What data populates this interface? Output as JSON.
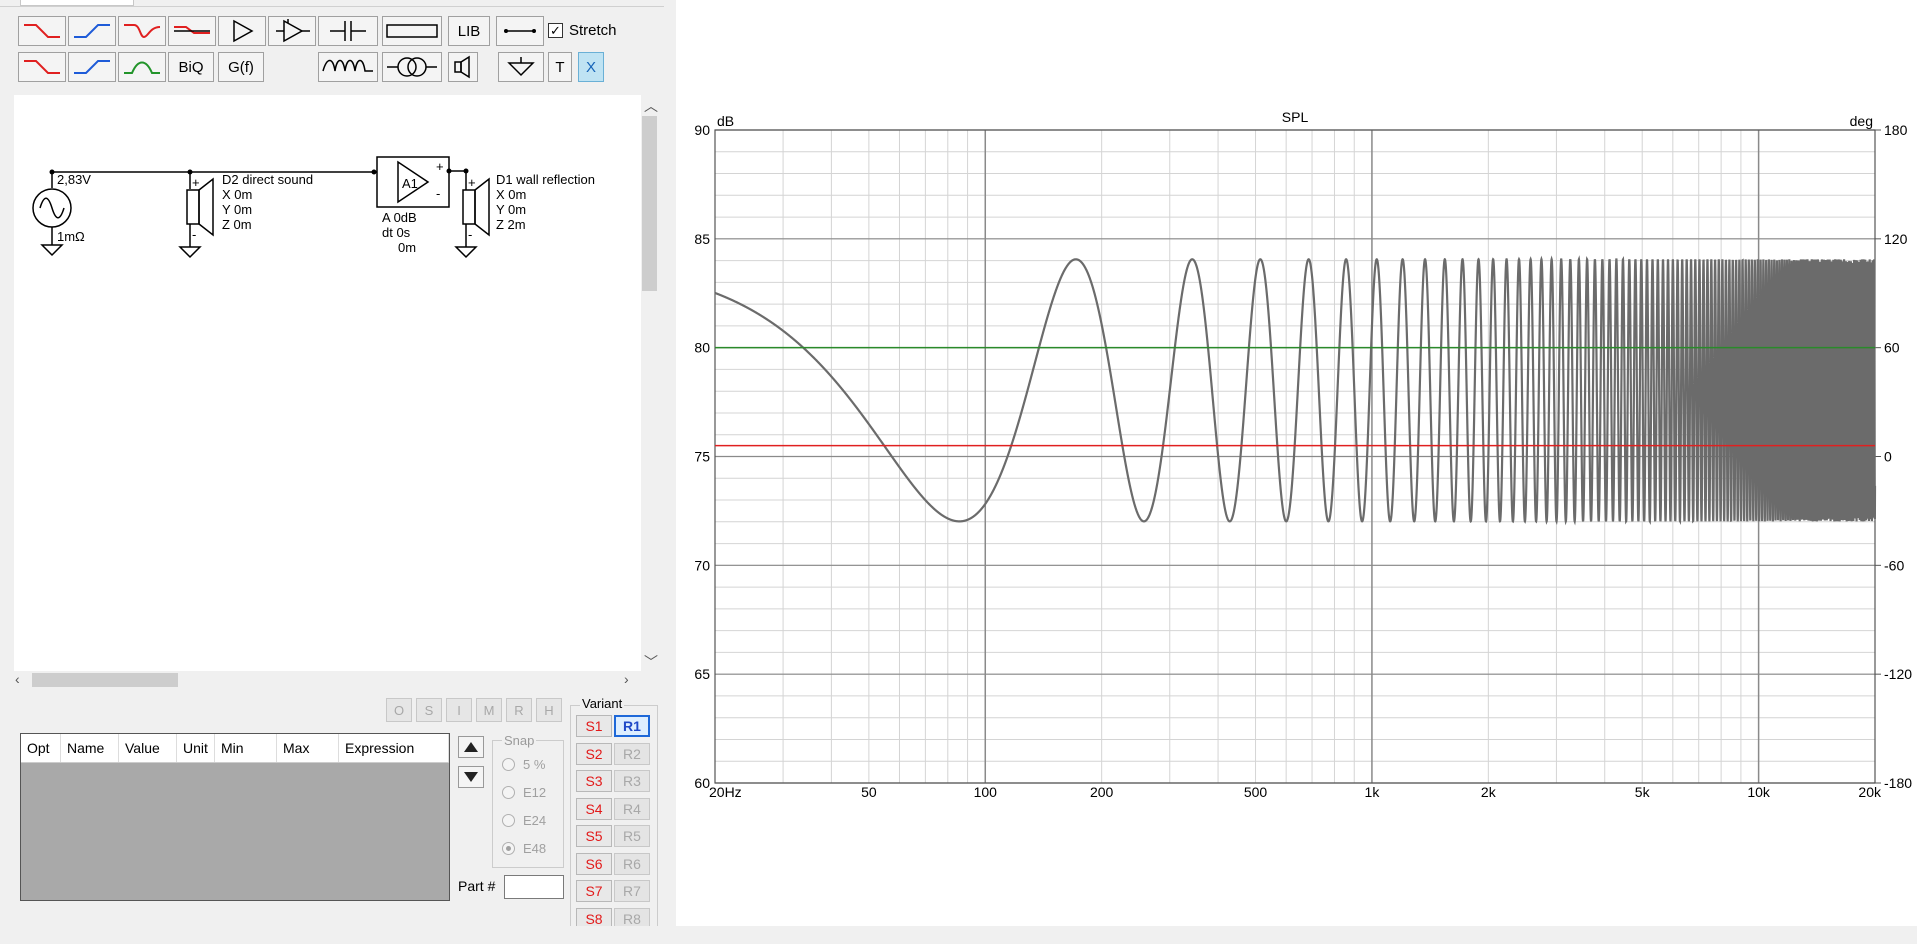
{
  "toolbar": {
    "row1": [
      {
        "name": "lowpass-red-icon",
        "kind": "lp",
        "color": "#e02020"
      },
      {
        "name": "highpass-blue-icon",
        "kind": "hp",
        "color": "#1e5bd8"
      },
      {
        "name": "bandstop-red-icon",
        "kind": "bs",
        "color": "#e02020"
      },
      {
        "name": "shelf-filter-icon",
        "kind": "shelf",
        "color": "#e02020"
      },
      {
        "name": "amplifier-icon",
        "kind": "amp",
        "color": "#000000"
      },
      {
        "name": "summing-amp-icon",
        "kind": "sum",
        "color": "#000000"
      },
      {
        "name": "capacitor-icon",
        "kind": "cap",
        "color": "#000000"
      },
      {
        "name": "resistor-icon",
        "kind": "res",
        "color": "#000000"
      },
      {
        "name": "lib-button",
        "kind": "text",
        "label": "LIB"
      },
      {
        "name": "wire-icon",
        "kind": "wire",
        "color": "#000000"
      }
    ],
    "row2": [
      {
        "name": "lowpass2-red-icon",
        "kind": "lp",
        "color": "#e02020"
      },
      {
        "name": "highpass2-blue-icon",
        "kind": "hp",
        "color": "#1e5bd8"
      },
      {
        "name": "bandpass-green-icon",
        "kind": "bp",
        "color": "#22942a"
      },
      {
        "name": "biquad-button",
        "kind": "text",
        "label": "BiQ"
      },
      {
        "name": "transfer-function-button",
        "kind": "text",
        "label": "G(f)"
      },
      {
        "name": "inductor-icon",
        "kind": "ind",
        "color": "#000000"
      },
      {
        "name": "transformer-icon",
        "kind": "trans",
        "color": "#000000"
      },
      {
        "name": "speaker-icon",
        "kind": "spk",
        "color": "#000000"
      },
      {
        "name": "ground-icon",
        "kind": "gnd",
        "color": "#000000"
      },
      {
        "name": "text-button",
        "kind": "text",
        "label": "T"
      },
      {
        "name": "x-button",
        "kind": "text",
        "label": "X"
      }
    ],
    "stretch_label": "Stretch",
    "stretch_checked": "✓"
  },
  "schematic": {
    "source_voltage": "2,83V",
    "source_impedance": "1mΩ",
    "d2_name": "D2 direct sound",
    "d2_x": "X 0m",
    "d2_y": "Y 0m",
    "d2_z": "Z 0m",
    "amp_name": "A1",
    "amp_gain": "A  0dB",
    "amp_dt": "dt 0s",
    "amp_dist": "0m",
    "d1_name": "D1 wall reflection",
    "d1_x": "X 0m",
    "d1_y": "Y 0m",
    "d1_z": "Z 2m",
    "plus": "+",
    "minus": "-"
  },
  "opt_buttons": [
    "O",
    "S",
    "I",
    "M",
    "R",
    "H"
  ],
  "param_table": {
    "columns": [
      "Opt",
      "Name",
      "Value",
      "Unit",
      "Min",
      "Max",
      "Expression"
    ]
  },
  "snap": {
    "title": "Snap",
    "options": [
      "5 %",
      "E12",
      "E24",
      "E48"
    ],
    "selected": "E48"
  },
  "part_label": "Part #",
  "variant": {
    "title": "Variant",
    "s_buttons": [
      "S1",
      "S2",
      "S3",
      "S4",
      "S5",
      "S6",
      "S7",
      "S8"
    ],
    "r_buttons": [
      "R1",
      "R2",
      "R3",
      "R4",
      "R5",
      "R6",
      "R7",
      "R8"
    ],
    "active": "R1"
  },
  "chart_data": {
    "type": "line",
    "title": "SPL",
    "ylabel": "dB",
    "y2label": "deg",
    "xscale": "log",
    "xlim": [
      20,
      20000
    ],
    "ylim": [
      60,
      90
    ],
    "y2lim": [
      -180,
      180
    ],
    "x_ticks": [
      "20Hz",
      "50",
      "100",
      "200",
      "500",
      "1k",
      "2k",
      "5k",
      "10k",
      "20k"
    ],
    "x_tick_values": [
      20,
      50,
      100,
      200,
      500,
      1000,
      2000,
      5000,
      10000,
      20000
    ],
    "y_ticks": [
      "90",
      "85",
      "80",
      "75",
      "70",
      "65",
      "60"
    ],
    "y_tick_values": [
      90,
      85,
      80,
      75,
      70,
      65,
      60
    ],
    "y2_ticks": [
      "180",
      "120",
      "60",
      "0",
      "-60",
      "-120",
      "-180"
    ],
    "y2_tick_values": [
      180,
      120,
      60,
      0,
      -60,
      -120,
      -180
    ],
    "grid": true,
    "series": [
      {
        "kind": "spl_comb",
        "color": "#6b6b6b",
        "base_db": 78.04,
        "ripple_db": 6.02,
        "delay_s": 0.005831
      },
      {
        "kind": "hline",
        "color": "#2a8a2a",
        "y": 80
      },
      {
        "kind": "hline",
        "color": "#e02020",
        "y": 75.5
      }
    ],
    "colors": {
      "major_grid": "#8a8a8a",
      "minor_grid": "#d4d4d4"
    }
  }
}
